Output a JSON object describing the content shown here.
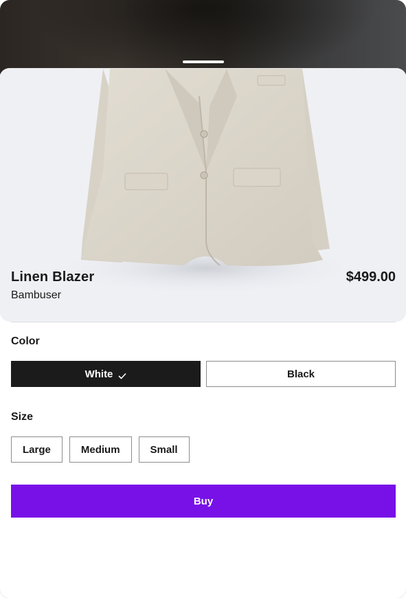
{
  "product": {
    "title": "Linen Blazer",
    "price": "$499.00",
    "brand": "Bambuser",
    "image_alt": "linen-blazer-photo"
  },
  "color": {
    "label": "Color",
    "options": [
      {
        "label": "White",
        "selected": true
      },
      {
        "label": "Black",
        "selected": false
      }
    ]
  },
  "size": {
    "label": "Size",
    "options": [
      {
        "label": "Large"
      },
      {
        "label": "Medium"
      },
      {
        "label": "Small"
      }
    ]
  },
  "buy": {
    "label": "Buy"
  },
  "colors": {
    "accent": "#7810e8",
    "selected_bg": "#1b1b1b",
    "image_bg": "#eef0f4"
  },
  "icons": {
    "selected_check": "check-icon"
  }
}
